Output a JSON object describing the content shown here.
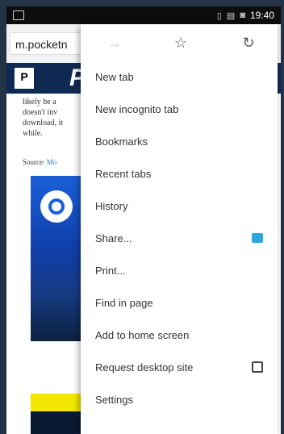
{
  "statusbar": {
    "time": "19:40"
  },
  "urlbar": {
    "url": "m.pocketn"
  },
  "site": {
    "logo_text": "P",
    "banner_text": "P"
  },
  "article": {
    "lines": [
      "likely be a",
      "doesn't inv",
      "download, it",
      "while."
    ],
    "source_label": "Source:",
    "source_link": "Mo"
  },
  "menu": {
    "items": [
      {
        "label": "New tab"
      },
      {
        "label": "New incognito tab"
      },
      {
        "label": "Bookmarks"
      },
      {
        "label": "Recent tabs"
      },
      {
        "label": "History"
      },
      {
        "label": "Share..."
      },
      {
        "label": "Print..."
      },
      {
        "label": "Find in page"
      },
      {
        "label": "Add to home screen"
      },
      {
        "label": "Request desktop site"
      },
      {
        "label": "Settings"
      }
    ]
  }
}
